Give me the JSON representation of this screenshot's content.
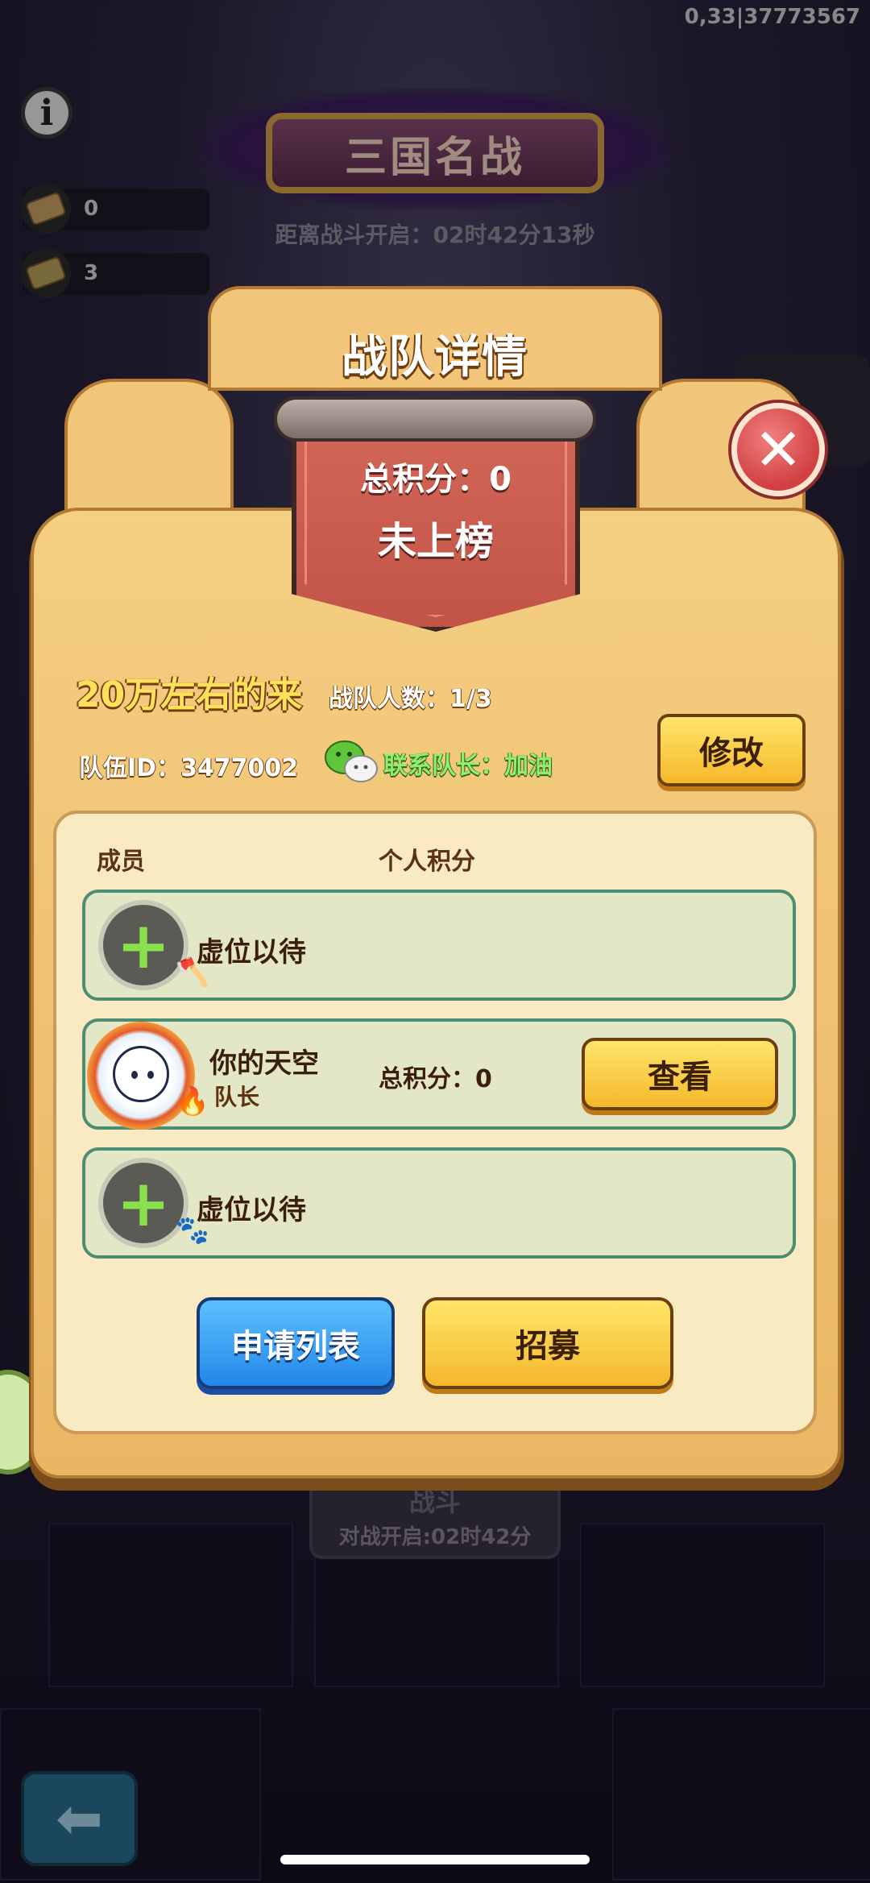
{
  "status": {
    "debug_code": "0,33|37773567"
  },
  "hud": {
    "resource_1": "0",
    "resource_2": "3"
  },
  "event": {
    "title": "三国名战",
    "countdown": "距离战斗开启：02时42分13秒"
  },
  "background_plate": {
    "line1": "战斗",
    "line2": "对战开启:02时42分"
  },
  "dialog": {
    "title": "战队详情",
    "total_score": "总积分：0",
    "rank_status": "未上榜",
    "team_name": "20万左右的来",
    "member_count": "战队人数：1/3",
    "team_id": "队伍ID：3477002",
    "contact": "联系队长：加油",
    "edit_button": "修改",
    "columns": {
      "member": "成员",
      "score": "个人积分"
    },
    "slots": [
      {
        "label": "虚位以待",
        "badge_icon": "axe-icon",
        "badge_color": "#d94b3d"
      },
      {
        "name": "你的天空",
        "role": "队长",
        "score": "总积分：0",
        "view_button": "查看",
        "badge_icon": "flame-icon",
        "badge_color": "#2f78e0"
      },
      {
        "label": "虚位以待",
        "badge_icon": "paw-icon",
        "badge_color": "#9b3fd1"
      }
    ],
    "apply_list_button": "申请列表",
    "recruit_button": "招募"
  },
  "colors": {
    "accent_yellow": "#f5b82c",
    "accent_blue": "#2287e8",
    "ribbon_red": "#c25447",
    "panel_bg": "#f9eac2"
  }
}
